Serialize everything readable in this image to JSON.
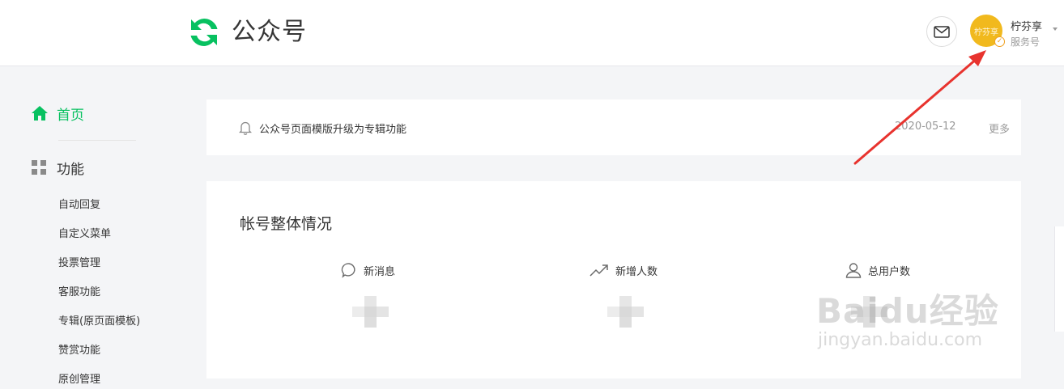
{
  "header": {
    "logo_text": "公众号",
    "account_name": "柠芬享",
    "account_type": "服务号",
    "avatar_text": "柠芬享"
  },
  "sidebar": {
    "home_label": "首页",
    "function_label": "功能",
    "items": [
      {
        "label": "自动回复"
      },
      {
        "label": "自定义菜单"
      },
      {
        "label": "投票管理"
      },
      {
        "label": "客服功能"
      },
      {
        "label": "专辑(原页面模板)"
      },
      {
        "label": "赞赏功能"
      },
      {
        "label": "原创管理"
      }
    ]
  },
  "notice": {
    "text": "公众号页面模版升级为专辑功能",
    "date": "2020-05-12",
    "more": "更多"
  },
  "overview": {
    "title": "帐号整体情况",
    "stats": [
      {
        "label": "新消息",
        "icon": "chat-bubble-icon"
      },
      {
        "label": "新增人数",
        "icon": "trend-up-icon"
      },
      {
        "label": "总用户数",
        "icon": "user-icon"
      }
    ]
  },
  "watermark": {
    "brand": "Baidu经验",
    "url": "jingyan.baidu.com"
  },
  "colors": {
    "accent": "#07c160",
    "annotation_arrow": "#e8332e",
    "avatar_bg": "#f1b91d"
  }
}
